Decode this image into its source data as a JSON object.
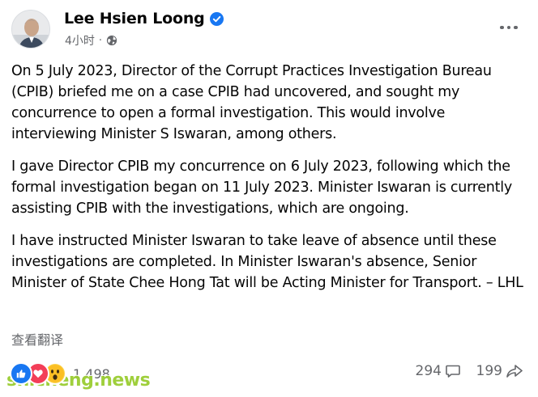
{
  "post": {
    "author": "Lee Hsien Loong",
    "time": "4小时",
    "audience_icon": "globe-icon",
    "paragraphs": [
      "On 5 July 2023, Director of the Corrupt Practices Investigation Bureau (CPIB) briefed me on a case CPIB had uncovered, and sought my concurrence to open a formal investigation. This would involve interviewing Minister S Iswaran, among others.",
      "I gave Director CPIB my concurrence on 6 July 2023, following which the formal investigation began on 11 July 2023. Minister Iswaran is currently assisting CPIB with the investigations, which are ongoing.",
      "I have instructed Minister Iswaran to take leave of absence until these investigations are completed. In Minister Iswaran's absence, Senior Minister of State Chee Hong Tat will be Acting Minister for Transport. – LHL"
    ],
    "translate_label": "查看翻译"
  },
  "footer": {
    "reaction_count": "1,498",
    "reactions": [
      "like-icon",
      "love-icon",
      "wow-icon"
    ],
    "comments_count": "294",
    "shares_count": "199"
  },
  "watermark": "shicheng.news",
  "colors": {
    "text": "#050505",
    "secondary": "#65676b",
    "verified": "#1877f2",
    "watermark": "#9acd32"
  }
}
